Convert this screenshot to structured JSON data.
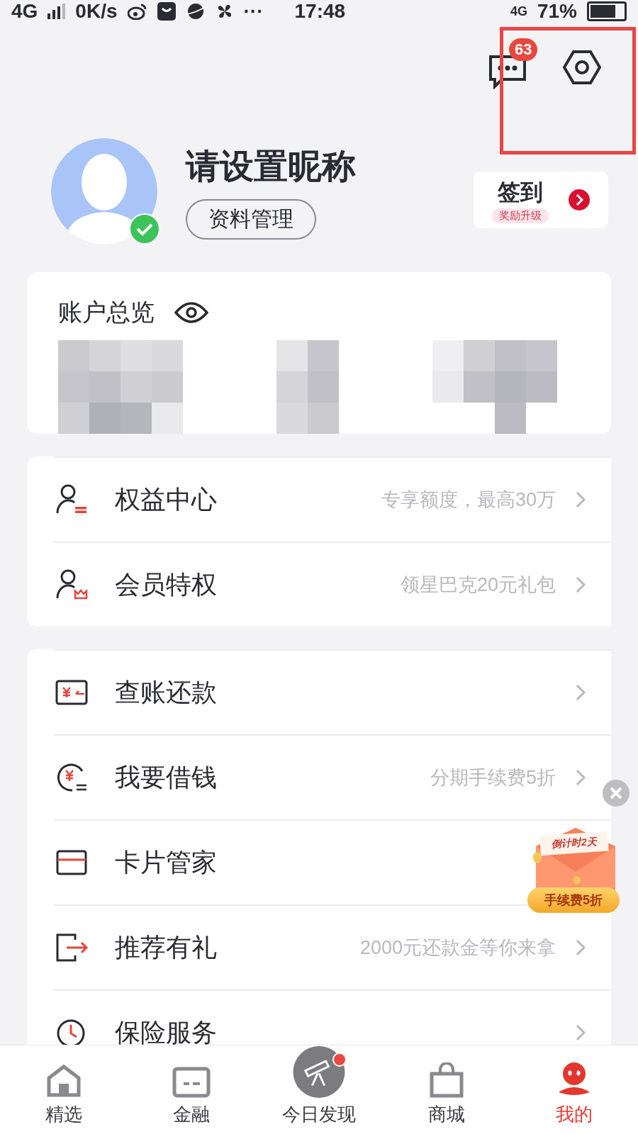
{
  "status_bar": {
    "network": "4G",
    "speed": "0K/s",
    "more": "···",
    "time": "17:48",
    "network_2": "4G",
    "battery": "71%"
  },
  "header": {
    "message_badge": "63"
  },
  "profile": {
    "nickname": "请设置昵称",
    "verified": true,
    "manage_button": "资料管理",
    "checkin": {
      "label": "签到",
      "tag": "奖励升级"
    }
  },
  "account": {
    "title": "账户总览"
  },
  "menu_groups": [
    {
      "items": [
        {
          "kind": "rights",
          "title": "权益中心",
          "subtitle": "专享额度，最高30万",
          "arrow": true
        },
        {
          "kind": "member",
          "title": "会员特权",
          "subtitle": "领星巴克20元礼包",
          "arrow": true
        }
      ]
    },
    {
      "items": [
        {
          "kind": "bill",
          "title": "查账还款",
          "arrow": true
        },
        {
          "kind": "loan",
          "title": "我要借钱",
          "subtitle": "分期手续费5折",
          "arrow": true
        },
        {
          "kind": "card",
          "title": "卡片管家",
          "arrow": false
        },
        {
          "kind": "share",
          "title": "推荐有礼",
          "subtitle": "2000元还款金等你来拿",
          "arrow": true
        },
        {
          "kind": "insurance",
          "title": "保险服务",
          "arrow": true
        }
      ]
    }
  ],
  "promo": {
    "countdown": "倒计时2天",
    "button": "手续费5折"
  },
  "tabs": [
    {
      "kind": "home",
      "label": "精选",
      "selected": false,
      "dot": false
    },
    {
      "kind": "finance",
      "label": "金融",
      "selected": false,
      "dot": false
    },
    {
      "kind": "discover",
      "label": "今日发现",
      "selected": false,
      "dot": true
    },
    {
      "kind": "mall",
      "label": "商城",
      "selected": false,
      "dot": false
    },
    {
      "kind": "mine",
      "label": "我的",
      "selected": true,
      "dot": false
    }
  ]
}
